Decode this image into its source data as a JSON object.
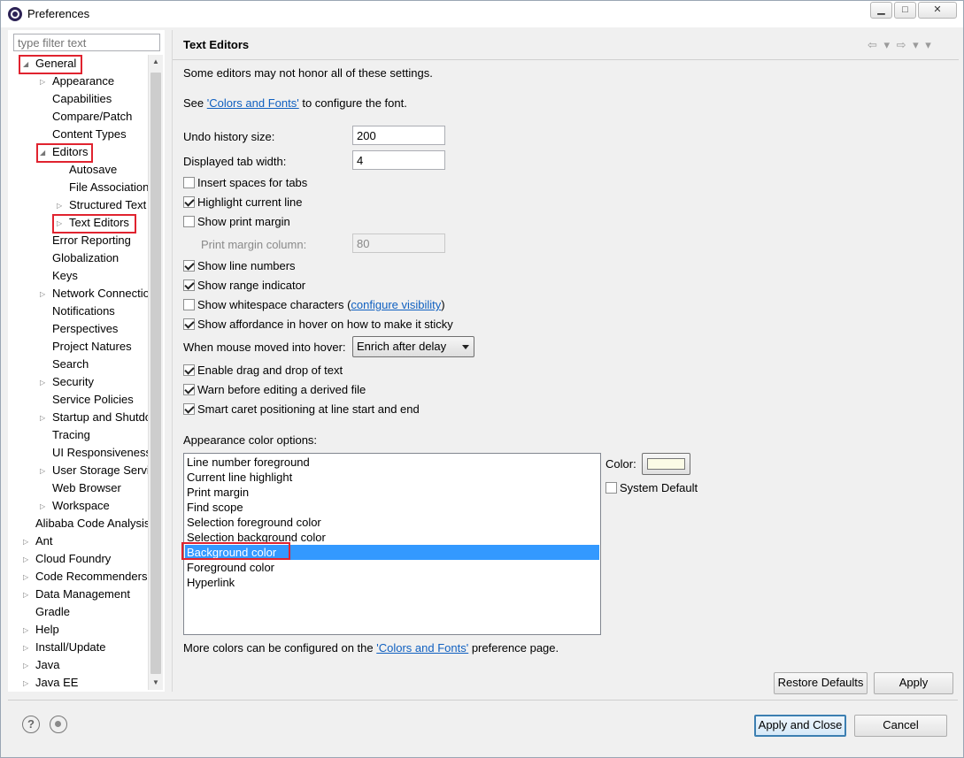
{
  "window": {
    "title": "Preferences",
    "controls": {
      "minimize": "▁",
      "maximize": "□",
      "close": "✕"
    }
  },
  "tree": {
    "filter_placeholder": "type filter text",
    "items": [
      {
        "label": "General",
        "arrow": "◢",
        "expanded": true
      },
      {
        "label": "Appearance",
        "arrow": "▷"
      },
      {
        "label": "Capabilities"
      },
      {
        "label": "Compare/Patch"
      },
      {
        "label": "Content Types"
      },
      {
        "label": "Editors",
        "arrow": "◢",
        "expanded": true
      },
      {
        "label": "Autosave"
      },
      {
        "label": "File Associations"
      },
      {
        "label": "Structured Text Editors",
        "arrow": "▷"
      },
      {
        "label": "Text Editors",
        "arrow": "▷",
        "selected": true
      },
      {
        "label": "Error Reporting"
      },
      {
        "label": "Globalization"
      },
      {
        "label": "Keys"
      },
      {
        "label": "Network Connections",
        "arrow": "▷"
      },
      {
        "label": "Notifications"
      },
      {
        "label": "Perspectives"
      },
      {
        "label": "Project Natures"
      },
      {
        "label": "Search"
      },
      {
        "label": "Security",
        "arrow": "▷"
      },
      {
        "label": "Service Policies"
      },
      {
        "label": "Startup and Shutdown",
        "arrow": "▷"
      },
      {
        "label": "Tracing"
      },
      {
        "label": "UI Responsiveness"
      },
      {
        "label": "User Storage Service",
        "arrow": "▷"
      },
      {
        "label": "Web Browser"
      },
      {
        "label": "Workspace",
        "arrow": "▷"
      },
      {
        "label": "Alibaba Code Analysis"
      },
      {
        "label": "Ant",
        "arrow": "▷"
      },
      {
        "label": "Cloud Foundry",
        "arrow": "▷"
      },
      {
        "label": "Code Recommenders",
        "arrow": "▷"
      },
      {
        "label": "Data Management",
        "arrow": "▷"
      },
      {
        "label": "Gradle"
      },
      {
        "label": "Help",
        "arrow": "▷"
      },
      {
        "label": "Install/Update",
        "arrow": "▷"
      },
      {
        "label": "Java",
        "arrow": "▷"
      },
      {
        "label": "Java EE",
        "arrow": "▷"
      }
    ]
  },
  "page": {
    "title": "Text Editors",
    "nav_icons": "⇦ ▾ ⇨ ▾ ▾",
    "note": "Some editors may not honor all of these settings.",
    "see_prefix": "See ",
    "colors_fonts_link": "'Colors and Fonts'",
    "see_suffix": " to configure the font.",
    "undo_label": "Undo history size:",
    "undo_value": "200",
    "tab_label": "Displayed tab width:",
    "tab_value": "4",
    "insert_spaces": "Insert spaces for tabs",
    "highlight_line": "Highlight current line",
    "show_print_margin": "Show print margin",
    "print_margin_label": "Print margin column:",
    "print_margin_value": "80",
    "show_line_numbers": "Show line numbers",
    "show_range": "Show range indicator",
    "show_whitespace": "Show whitespace characters (",
    "configure_visibility": "configure visibility",
    "close_paren": ")",
    "show_affordance": "Show affordance in hover on how to make it sticky",
    "hover_label": "When mouse moved into hover:",
    "hover_value": "Enrich after delay",
    "drag_drop": "Enable drag and drop of text",
    "warn_derived": "Warn before editing a derived file",
    "smart_caret": "Smart caret positioning at line start and end",
    "appearance_label": "Appearance color options:",
    "color_items": [
      "Line number foreground",
      "Current line highlight",
      "Print margin",
      "Find scope",
      "Selection foreground color",
      "Selection background color",
      "Background color",
      "Foreground color",
      "Hyperlink"
    ],
    "color_label": "Color:",
    "system_default": "System Default",
    "more_prefix": "More colors can be configured on the ",
    "more_link": "'Colors and Fonts'",
    "more_suffix": " preference page.",
    "restore_defaults": "Restore Defaults",
    "apply": "Apply"
  },
  "footer": {
    "help_icon": "?",
    "apply_close": "Apply and Close",
    "cancel": "Cancel"
  },
  "colors": {
    "selection": "#3399ff",
    "link": "#1060c0",
    "highlight_box": "#e0232f",
    "swatch": "#fbfbe6"
  }
}
